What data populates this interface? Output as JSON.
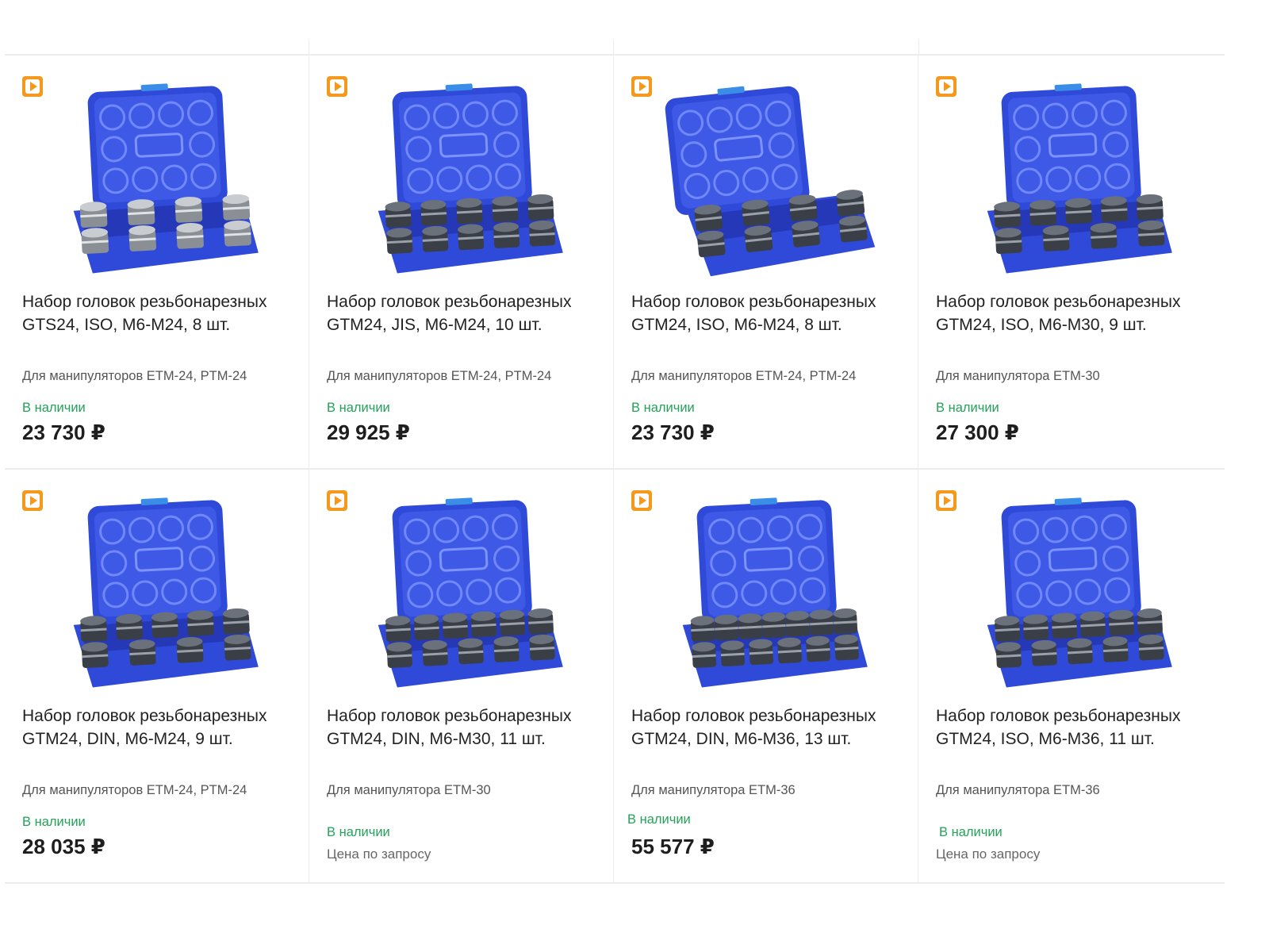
{
  "products": [
    {
      "title": "Набор головок резьбонарезных GTS24, ISO, M6-M24, 8 шт.",
      "subtitle": "Для манипуляторов ETM-24, PTM-24",
      "stock": "В наличии",
      "price": "23 730 ₽",
      "price_request": "",
      "style": "open",
      "count": 8
    },
    {
      "title": "Набор головок резьбонарезных GTM24, JIS, M6-M24, 10 шт.",
      "subtitle": "Для манипуляторов ETM-24, PTM-24",
      "stock": "В наличии",
      "price": "29 925 ₽",
      "price_request": "",
      "style": "dark",
      "count": 10
    },
    {
      "title": "Набор головок резьбонарезных GTM24, ISO, M6-M24, 8 шт.",
      "subtitle": "Для манипуляторов ETM-24, PTM-24",
      "stock": "В наличии",
      "price": "23 730 ₽",
      "price_request": "",
      "style": "tilted",
      "count": 8
    },
    {
      "title": "Набор головок резьбонарезных GTM24, ISO, M6-M30, 9 шт.",
      "subtitle": "Для манипулятора ETM-30",
      "stock": "В наличии",
      "price": "27 300 ₽",
      "price_request": "",
      "style": "dark",
      "count": 9
    },
    {
      "title": "Набор головок резьбонарезных GTM24, DIN, M6-M24, 9 шт.",
      "subtitle": "Для манипуляторов ETM-24, PTM-24",
      "stock": "В наличии",
      "price": "28 035 ₽",
      "price_request": "",
      "style": "dark",
      "count": 9
    },
    {
      "title": "Набор головок резьбонарезных GTM24, DIN, M6-M30, 11 шт.",
      "subtitle": "Для манипулятора ETM-30",
      "stock": "В наличии",
      "price": "",
      "price_request": "Цена по запросу",
      "style": "dark",
      "count": 11
    },
    {
      "title": "Набор головок резьбонарезных GTM24, DIN, M6-M36, 13 шт.",
      "subtitle": "Для манипулятора ETM-36",
      "stock": "В наличии",
      "price": "55 577 ₽",
      "price_request": "",
      "style": "dark",
      "count": 13
    },
    {
      "title": "Набор головок резьбонарезных GTM24, ISO, M6-M36, 11 шт.",
      "subtitle": "Для манипулятора ETM-36",
      "stock": "В наличии",
      "price": "",
      "price_request": "Цена по запросу",
      "style": "dark",
      "count": 11
    }
  ],
  "icons": {
    "badge": "video-play-icon"
  },
  "colors": {
    "badge": "#f39a1e",
    "stock": "#25a15a",
    "case_blue": "#2f4ad8",
    "case_blue_light": "#4b66f0"
  }
}
